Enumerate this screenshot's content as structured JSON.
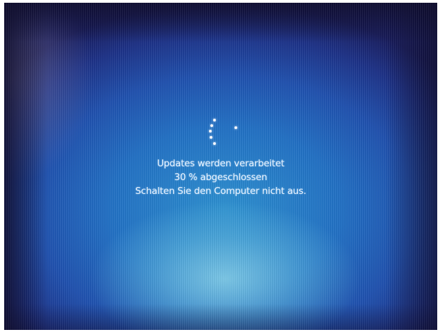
{
  "update_screen": {
    "line1": "Updates werden verarbeitet",
    "line2": "30 % abgeschlossen",
    "line3": "Schalten Sie den Computer nicht aus.",
    "progress_percent": 30,
    "spinner_icon": "loading-spinner-icon",
    "colors": {
      "background_center": "#2a8fd0",
      "background_edge": "#15195a",
      "text": "#e8f3ff"
    }
  }
}
